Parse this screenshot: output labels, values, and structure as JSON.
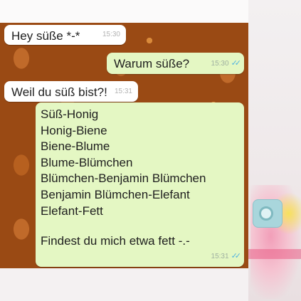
{
  "messages": [
    {
      "direction": "in",
      "text": "Hey süße *-*",
      "time": "15:30"
    },
    {
      "direction": "out",
      "text": "Warum süße?",
      "time": "15:30",
      "status": "read"
    },
    {
      "direction": "in",
      "text": "Weil du süß bist?!",
      "time": "15:31"
    },
    {
      "direction": "out",
      "lines": [
        "Süß-Honig",
        "Honig-Biene",
        "Biene-Blume",
        "Blume-Blümchen",
        "Blümchen-Benjamin Blümchen",
        "Benjamin Blümchen-Elefant",
        "Elefant-Fett"
      ],
      "question": "Findest du mich etwa fett -.-",
      "time": "15:31",
      "status": "read"
    }
  ],
  "icons": {
    "read_receipt": "double-check-icon"
  },
  "colors": {
    "chat_wallpaper": "#9a4a14",
    "incoming_bubble": "#ffffff",
    "outgoing_bubble": "#e4f7c3",
    "read_tick": "#4fb2e0"
  }
}
